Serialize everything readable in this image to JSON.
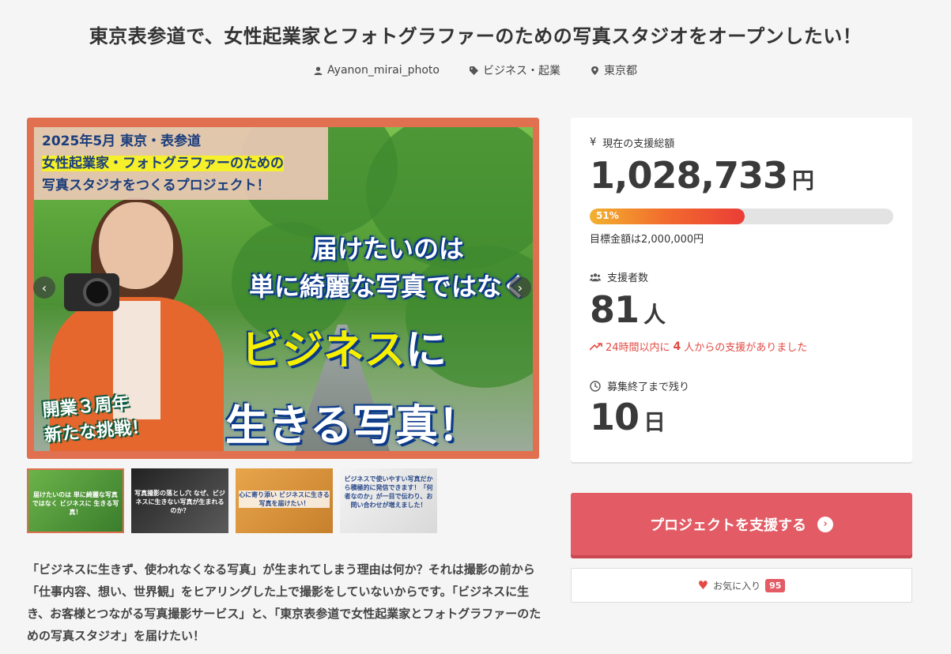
{
  "title": "東京表参道で、女性起業家とフォトグラファーのための写真スタジオをオープンしたい！",
  "meta": {
    "owner": "Ayanon_mirai_photo",
    "category": "ビジネス・起業",
    "location": "東京都"
  },
  "hero": {
    "badge_line1": "2025年5月 東京・表参道",
    "badge_line2": "女性起業家・フォトグラファーのための",
    "badge_line3": "写真スタジオをつくるプロジェクト！",
    "text_line1": "届けたいのは",
    "text_line2": "単に綺麗な写真ではなく",
    "text_line3a": "ビジネス",
    "text_line3b": "に",
    "text_line4": "生きる写真！",
    "anniv_line1": "開業３周年",
    "anniv_line2": "新たな挑戦！",
    "prev_icon": "‹",
    "next_icon": "›"
  },
  "thumbnails": [
    {
      "caption": "届けたいのは 単に綺麗な写真ではなく ビジネスに 生きる写真！"
    },
    {
      "caption": "写真撮影の落とし穴 なぜ、ビジネスに生きない写真が生まれるのか？"
    },
    {
      "caption": "心に寄り添い ビジネスに生きる写真を届けたい！"
    },
    {
      "caption": "ビジネスで使いやすい写真だから積極的に発信できます！「何者なのか」が一目で伝わり、お問い合わせが増えました！"
    }
  ],
  "description": "「ビジネスに生きず、使われなくなる写真」が生まれてしまう理由は何か？それは撮影の前から「仕事内容、想い、世界観」をヒアリングした上で撮影をしていないからです。「ビジネスに生き、お客様とつながる写真撮影サービス」と、「東京表参道で女性起業家とフォトグラファーのための写真スタジオ」を届けたい！",
  "stats": {
    "total_label": "現在の支援総額",
    "total_amount": "1,028,733",
    "total_unit": "円",
    "progress_percent": 51,
    "progress_label": "51%",
    "goal_text": "目標金額は2,000,000円",
    "backers_label": "支援者数",
    "backers_count": "81",
    "backers_unit": "人",
    "recent_prefix": "24時間以内に",
    "recent_count": "4",
    "recent_suffix": "人からの支援がありました",
    "remaining_label": "募集終了まで残り",
    "remaining_days": "10",
    "remaining_unit": "日"
  },
  "actions": {
    "support_label": "プロジェクトを支援する",
    "favorite_label": "お気に入り",
    "favorite_count": "95"
  },
  "colors": {
    "accent": "#e35b64",
    "hero_frame": "#e07050",
    "alert": "#e24b44"
  }
}
